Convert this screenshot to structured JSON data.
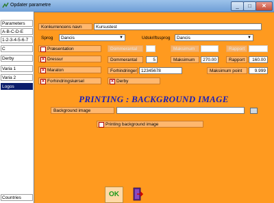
{
  "window": {
    "title": "Opdater parametre"
  },
  "sidebar": {
    "items": [
      {
        "label": "Parameters"
      },
      {
        "label": "A-B-C-D-E"
      },
      {
        "label": "1-2-3-4-5-6-7"
      },
      {
        "label": "C"
      },
      {
        "label": "Derby"
      },
      {
        "label": "Varia 1"
      },
      {
        "label": "Varia 2"
      },
      {
        "label": "Logos"
      }
    ],
    "bottom_item": {
      "label": "Countries"
    }
  },
  "form": {
    "competition_name_label": "Konkurrencens navn",
    "competition_name_value": "Kursustest",
    "language_label": "Sprog",
    "language_value": "Dancis",
    "print_language_label": "Udskriftssprog",
    "print_language_value": "Dancis",
    "presentation_label": "Præsentation",
    "presentation_checked": false,
    "dressur_label": "Dressur",
    "dressur_checked": true,
    "maraton_label": "Maraton",
    "maraton_checked": true,
    "forhindring_label": "Forhindringskørsel",
    "forhindring_checked": true,
    "derby_label": "Derby",
    "derby_checked": true,
    "dimmed1_label": "Dommerantal",
    "dimmed2_label": "Maksimum",
    "dimmed3_label": "Rapport",
    "judges_label": "Dommerantal",
    "judges_value": "5",
    "max_label": "Maksimum",
    "max_value": "270.00",
    "report_label": "Rapport",
    "report_value": "160.00",
    "obstacles_label": "Forhindringer",
    "obstacles_value": "12345678",
    "max_point_label": "Maksimum point",
    "max_point_value": "9.999"
  },
  "section": {
    "heading": "PRINTING : BACKGROUND IMAGE",
    "bg_image_label": "Background image",
    "bg_image_value": "",
    "printing_bg_label": "Printing background image",
    "printing_bg_checked": false
  },
  "buttons": {
    "ok_label": "OK"
  },
  "colors": {
    "background": "#ff9a1f",
    "heading": "#1d1fb6",
    "active_tab": "#0b1d6b"
  }
}
